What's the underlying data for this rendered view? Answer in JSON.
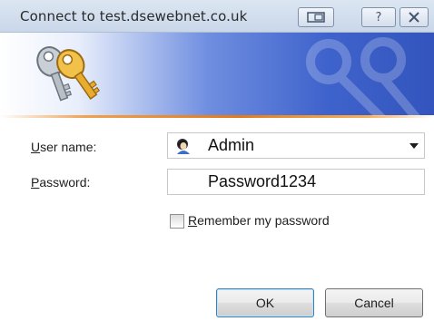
{
  "window": {
    "title": "Connect to test.dsewebnet.co.uk",
    "help_glyph": "?"
  },
  "banner": {
    "icon": "keys-icon",
    "watermark_icon": "keys-watermark-icon"
  },
  "form": {
    "username": {
      "label_accel": "U",
      "label_rest": "ser name:",
      "value": "Admin",
      "icon": "user-icon"
    },
    "password": {
      "label_accel": "P",
      "label_rest": "assword:",
      "value": "Password1234"
    },
    "remember": {
      "label_accel": "R",
      "label_rest": "emember my password",
      "checked": false
    }
  },
  "buttons": {
    "ok": "OK",
    "cancel": "Cancel"
  },
  "colors": {
    "banner_blue": "#3f63cc",
    "banner_accent_line": "#e07a1c",
    "titlebar": "#c9d7ea"
  }
}
